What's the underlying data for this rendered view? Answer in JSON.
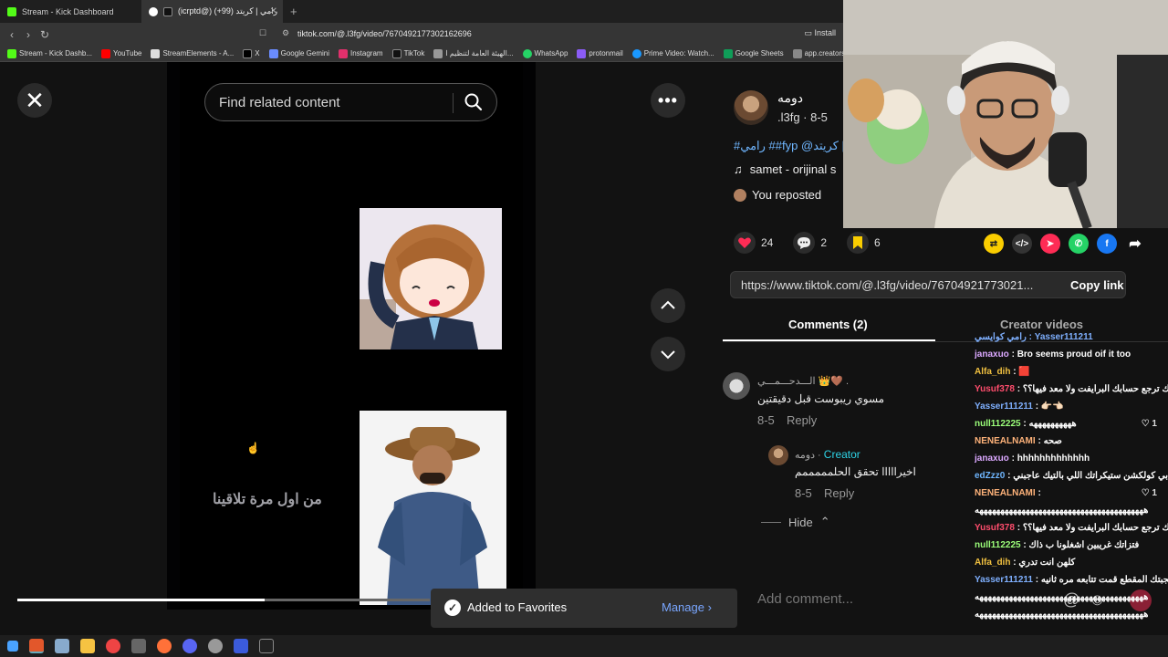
{
  "browser": {
    "tabs": [
      {
        "title": "Stream - Kick Dashboard",
        "active": false
      },
      {
        "title": "(icrptd@) رامي | كريتد (99+)",
        "active": true
      }
    ],
    "url": "tiktok.com/@.l3fg/video/7670492177302162696",
    "install_label": "Install",
    "bookmarks": [
      "Stream - Kick Dashb...",
      "YouTube",
      "StreamElements - A...",
      "X",
      "Google Gemini",
      "Instagram",
      "TikTok",
      "الهيئة العامة لتنظيم ا...",
      "WhatsApp",
      "protonmail",
      "Prime Video: Watch...",
      "Google Sheets",
      "app.creators.sa/das..."
    ]
  },
  "player": {
    "search_placeholder": "Find related content",
    "caption": "من اول مرة تلاقينا",
    "progress": 0.6
  },
  "toast": {
    "text": "Added to Favorites",
    "manage": "Manage"
  },
  "post": {
    "author_name": "دومه",
    "author_sub": ".l3fg · 8-5",
    "tags": "#رامي ##fyp @كريتد |",
    "music": "samet - orijinal s",
    "reposted": "You reposted",
    "likes": "24",
    "comments": "2",
    "saves": "6",
    "link": "https://www.tiktok.com/@.l3fg/video/76704921773021...",
    "copy_link": "Copy link"
  },
  "comment_tabs": {
    "comments": "Comments (2)",
    "creator_videos": "Creator videos"
  },
  "comments": [
    {
      "user": "الـــدحـــمـــي 👑🤎 .",
      "text": "مسوي ريبوست قبل دقيقتين",
      "date": "8-5",
      "reply": "Reply"
    },
    {
      "user": "دومه · ",
      "badge": "Creator",
      "text": "اخيرااااا تحقق الحلمممممم",
      "date": "8-5",
      "reply": "Reply"
    }
  ],
  "hide_label": "Hide",
  "add_comment_placeholder": "Add comment...",
  "chat": [
    {
      "user": "",
      "msg": "رامي كوايسي : Yasser111211",
      "color": "#7fb0ff"
    },
    {
      "user": "janaxuo",
      "msg": "Bro seems proud oif it too",
      "color": "#dba8ff"
    },
    {
      "user": "Alfa_dih",
      "msg": "🟥",
      "color": "#f0c040"
    },
    {
      "user": "Yusuf378",
      "msg": "يمديك ترجع حسابك البرايفت ولا معد فيها؟؟",
      "color": "#ff4d6d"
    },
    {
      "user": "Yasser111211",
      "msg": "👉🏻👈🏻",
      "color": "#7fb0ff"
    },
    {
      "user": "null112225",
      "msg": "ههههههههههه",
      "color": "#9cff7a"
    },
    {
      "user": "NENEALNAMI",
      "msg": "صحه",
      "color": "#ffb37a"
    },
    {
      "user": "janaxuo",
      "msg": "hhhhhhhhhhhhh",
      "color": "#dba8ff"
    },
    {
      "user": "edZzz0",
      "msg": "رامي ابي كولكشن ستيكراتك اللي بالتيك عاجبني",
      "color": "#6fb6ff"
    },
    {
      "user": "NENEALNAMI",
      "msg": "",
      "color": "#ffb37a"
    },
    {
      "user": "",
      "msg": "ههههههههههههههههههههههههههههههههههههههههه",
      "color": "#fff"
    },
    {
      "user": "Yusuf378",
      "msg": "يمديك ترجع حسابك البرايفت ولا معد فيها؟؟",
      "color": "#ff4d6d"
    },
    {
      "user": "null112225",
      "msg": "فتزاتك غريبين اشغلونا ب ذاك",
      "color": "#9cff7a"
    },
    {
      "user": "Alfa_dih",
      "msg": "كلهن انت تدري",
      "color": "#f0c040"
    },
    {
      "user": "Yasser111211",
      "msg": "رامي الواقع الها عجبتك المقطع قمت تتابعه مره ثانيه",
      "color": "#7fb0ff"
    },
    {
      "user": "",
      "msg": "ههههههههههههههههههههههههههههههههههههههههه",
      "color": "#fff"
    },
    {
      "user": "",
      "msg": "ههههههههههههههههههههههههههههههههههههههههه",
      "color": "#fff"
    }
  ],
  "colors": {
    "like": "#fe2c55",
    "save": "#facd00",
    "accent_link": "#6fb6ff",
    "creator_badge": "#2ed3e6",
    "manage": "#79a6ff"
  }
}
